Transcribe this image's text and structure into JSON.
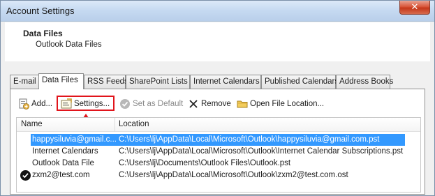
{
  "window": {
    "title": "Account Settings",
    "close_glyph": "✕"
  },
  "header": {
    "title": "Data Files",
    "subtitle": "Outlook Data Files"
  },
  "tabs": [
    {
      "label": "E-mail"
    },
    {
      "label": "Data Files",
      "active": true
    },
    {
      "label": "RSS Feeds"
    },
    {
      "label": "SharePoint Lists"
    },
    {
      "label": "Internet Calendars"
    },
    {
      "label": "Published Calendars"
    },
    {
      "label": "Address Books"
    }
  ],
  "toolbar": {
    "add": {
      "label": "Add...",
      "icon": "add-file-icon"
    },
    "settings": {
      "label": "Settings...",
      "icon": "settings-icon"
    },
    "set_default": {
      "label": "Set as Default",
      "icon": "checkmark-icon",
      "disabled": true
    },
    "remove": {
      "label": "Remove",
      "icon": "x-remove-icon"
    },
    "open_location": {
      "label": "Open File Location...",
      "icon": "folder-icon"
    }
  },
  "list": {
    "columns": [
      "Name",
      "Location"
    ],
    "rows": [
      {
        "name": "happysiluvia@gmail.c...",
        "location": "C:\\Users\\lj\\AppData\\Local\\Microsoft\\Outlook\\happysiluvia@gmail.com.pst",
        "selected": true,
        "default": false
      },
      {
        "name": "Internet Calendars",
        "location": "C:\\Users\\lj\\AppData\\Local\\Microsoft\\Outlook\\Internet Calendar Subscriptions.pst",
        "selected": false,
        "default": false
      },
      {
        "name": "Outlook Data File",
        "location": "C:\\Users\\lj\\Documents\\Outlook Files\\Outlook.pst",
        "selected": false,
        "default": false
      },
      {
        "name": "zxm2@test.com",
        "location": "C:\\Users\\lj\\AppData\\Local\\Microsoft\\Outlook\\zxm2@test.com.ost",
        "selected": false,
        "default": true
      }
    ]
  },
  "colors": {
    "selection": "#3399ff",
    "highlight_annotation": "#e1141b",
    "close_button": "#c5371a"
  }
}
